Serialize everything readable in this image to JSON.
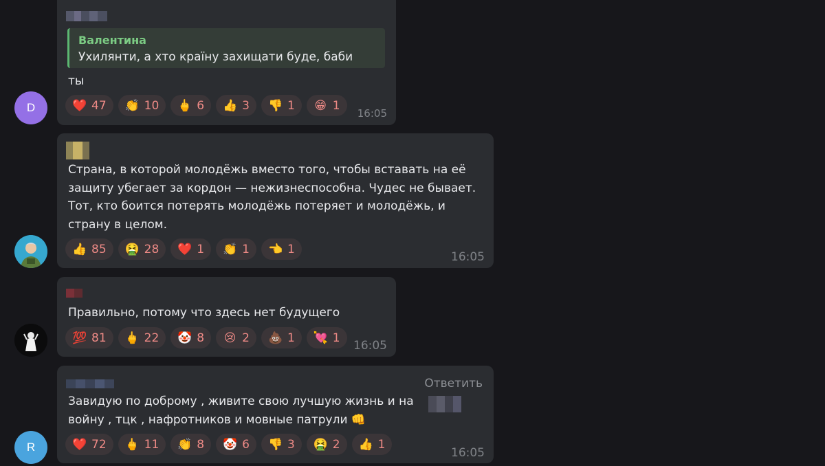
{
  "messages": [
    {
      "avatar": {
        "letter": "D",
        "color": "#9470e6"
      },
      "quote": {
        "author": "Валентина",
        "text": "Ухилянти,  а хто країну захищати буде, баби"
      },
      "text": "ты",
      "reactions": [
        {
          "icon": "heart",
          "glyph": "❤️",
          "count": "47"
        },
        {
          "icon": "clapping-hands",
          "glyph": "👏",
          "count": "10"
        },
        {
          "icon": "middle-finger",
          "glyph": "🖕",
          "count": "6"
        },
        {
          "icon": "thumbs-up",
          "glyph": "👍",
          "count": "3"
        },
        {
          "icon": "thumbs-down",
          "glyph": "👎",
          "count": "1"
        },
        {
          "icon": "grinning-face",
          "glyph": "😁",
          "count": "1"
        }
      ],
      "time": "16:05"
    },
    {
      "avatar": {
        "letter": "",
        "color": "#2f9ad0"
      },
      "text": "Страна, в которой молодёжь вместо того, чтобы вставать на её\nзащиту убегает за кордон — нежизнеспособна. Чудес не бывает.\nТот, кто боится потерять молодёжь потеряет и молодёжь, и\nстрану в целом.",
      "reactions": [
        {
          "icon": "thumbs-up",
          "glyph": "👍",
          "count": "85"
        },
        {
          "icon": "vomiting-face",
          "glyph": "🤮",
          "count": "28"
        },
        {
          "icon": "heart",
          "glyph": "❤️",
          "count": "1"
        },
        {
          "icon": "clapping-hands",
          "glyph": "👏",
          "count": "1"
        },
        {
          "icon": "pointing-hand",
          "glyph": "👈",
          "count": "1"
        }
      ],
      "time": "16:05"
    },
    {
      "avatar": {
        "letter": "",
        "color": "#0b0b0c"
      },
      "text": "Правильно, потому что здесь нет будущего",
      "reactions": [
        {
          "icon": "hundred-points",
          "glyph": "💯",
          "count": "81"
        },
        {
          "icon": "middle-finger",
          "glyph": "🖕",
          "count": "22"
        },
        {
          "icon": "clown-face",
          "glyph": "🤡",
          "count": "8"
        },
        {
          "icon": "crying-face",
          "glyph": "😢",
          "count": "2"
        },
        {
          "icon": "pile-of-poo",
          "glyph": "💩",
          "count": "1"
        },
        {
          "icon": "heart-with-arrow",
          "glyph": "💘",
          "count": "1"
        }
      ],
      "time": "16:05"
    },
    {
      "avatar": {
        "letter": "R",
        "color": "#4aa4de"
      },
      "reply_label": "Ответить",
      "text": "Завидую по доброму , живите свою лучшую жизнь и на\nвойну , тцк , нафротников и мовные патрули 👊",
      "reactions": [
        {
          "icon": "heart",
          "glyph": "❤️",
          "count": "72"
        },
        {
          "icon": "middle-finger",
          "glyph": "🖕",
          "count": "11"
        },
        {
          "icon": "clapping-hands",
          "glyph": "👏",
          "count": "8"
        },
        {
          "icon": "clown-face",
          "glyph": "🤡",
          "count": "6"
        },
        {
          "icon": "thumbs-down",
          "glyph": "👎",
          "count": "3"
        },
        {
          "icon": "vomiting-face",
          "glyph": "🤮",
          "count": "2"
        },
        {
          "icon": "thumbs-up",
          "glyph": "👍",
          "count": "1"
        }
      ],
      "time": "16:05"
    }
  ],
  "colors": {
    "background": "#17171b",
    "bubble": "#2b2d31",
    "reaction_pill": "#3b3538",
    "reaction_count": "#ee8a86",
    "quote_accent": "#5cb872",
    "timestamp": "#7f8287"
  }
}
